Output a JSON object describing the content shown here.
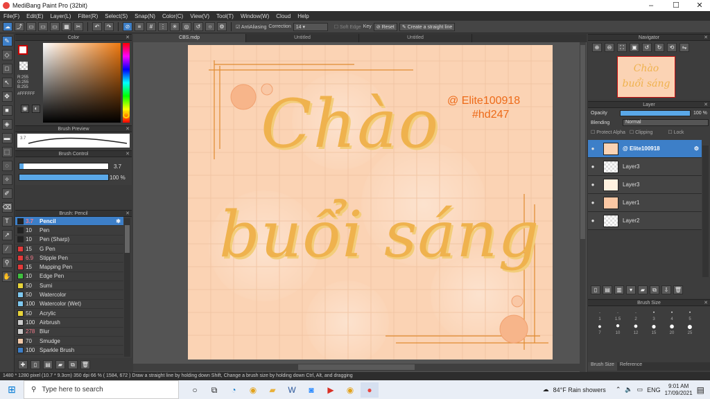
{
  "app": {
    "title": "MediBang Paint Pro (32bit)",
    "window_controls": [
      "–",
      "☐",
      "✕"
    ]
  },
  "menu": [
    "File(F)",
    "Edit(E)",
    "Layer(L)",
    "Filter(R)",
    "Select(S)",
    "Snap(N)",
    "Color(C)",
    "View(V)",
    "Tool(T)",
    "Window(W)",
    "Cloud",
    "Help"
  ],
  "toolbar": {
    "antialias": "AntiAliasing",
    "correction_label": "Correction",
    "correction_value": "14",
    "soft_edge": "Soft Edge",
    "key": "Key",
    "reset": "Reset",
    "straight_line": "Create a straight line"
  },
  "color_panel": {
    "title": "Color",
    "rgb": [
      "R:255",
      "G:255",
      "B:255"
    ],
    "hex": "#FFFFFF"
  },
  "brush_preview": {
    "title": "Brush Preview",
    "size": "3.7"
  },
  "brush_control": {
    "title": "Brush Control",
    "size": "3.7",
    "opacity": "100 %"
  },
  "brush_list": {
    "title": "Brush: Pencil",
    "items": [
      {
        "size": "3.7",
        "name": "Pencil",
        "color": "#222222"
      },
      {
        "size": "10",
        "name": "Pen",
        "color": "#222222"
      },
      {
        "size": "10",
        "name": "Pen (Sharp)",
        "color": "#222222"
      },
      {
        "size": "15",
        "name": "G Pen",
        "color": "#e23a3a"
      },
      {
        "size": "6.9",
        "name": "Stipple Pen",
        "color": "#e23a3a"
      },
      {
        "size": "15",
        "name": "Mapping Pen",
        "color": "#e23a3a"
      },
      {
        "size": "10",
        "name": "Edge Pen",
        "color": "#3fbf3f"
      },
      {
        "size": "50",
        "name": "Sumi",
        "color": "#e8d43a"
      },
      {
        "size": "50",
        "name": "Watercolor",
        "color": "#7ec8f0"
      },
      {
        "size": "100",
        "name": "Watercolor (Wet)",
        "color": "#7ec8f0"
      },
      {
        "size": "50",
        "name": "Acrylic",
        "color": "#e8d43a"
      },
      {
        "size": "100",
        "name": "Airbrush",
        "color": "#cccccc"
      },
      {
        "size": "278",
        "name": "Blur",
        "color": "#cccccc"
      },
      {
        "size": "70",
        "name": "Smudge",
        "color": "#f0c8a8"
      },
      {
        "size": "100",
        "name": "Sparkle Brush",
        "color": "#3d7fc8"
      }
    ]
  },
  "tabs": [
    "CBS.mdp",
    "Untitled",
    "Untitled"
  ],
  "canvas": {
    "line1": "Chào",
    "line2": "buổi sáng",
    "credit1": "@ Elite100918",
    "credit2": "#hd247"
  },
  "navigator": {
    "title": "Navigator",
    "thumb_text": [
      "Chào",
      "buổi sáng"
    ]
  },
  "layer_panel": {
    "title": "Layer",
    "opacity_label": "Opacity",
    "opacity_value": "100 %",
    "blending_label": "Blending",
    "blending_value": "Normal",
    "protect_alpha": "Protect Alpha",
    "clipping": "Clipping",
    "lock": "Lock",
    "layers": [
      "@ Elite100918",
      "Layer3",
      "Layer3",
      "Layer1",
      "Layer2"
    ]
  },
  "brush_size_panel": {
    "title": "Brush Size",
    "sizes_row1": [
      "1",
      "1.5",
      "2",
      "3",
      "4",
      "5"
    ],
    "sizes_row2": [
      "7",
      "10",
      "12",
      "15",
      "20",
      "25"
    ],
    "tabs": [
      "Brush Size",
      "Reference"
    ]
  },
  "statusbar": "1480 * 1280 pixel   (10.7 * 9.3cm)   350 dpi   66 %   ( 1584, 672 )   Draw a straight line by holding down Shift, Change a brush size by holding down Ctrl, Alt, and dragging",
  "taskbar": {
    "search_placeholder": "Type here to search",
    "weather": "84°F  Rain showers",
    "lang": "ENG",
    "time": "9:01 AM",
    "date": "17/09/2021"
  }
}
